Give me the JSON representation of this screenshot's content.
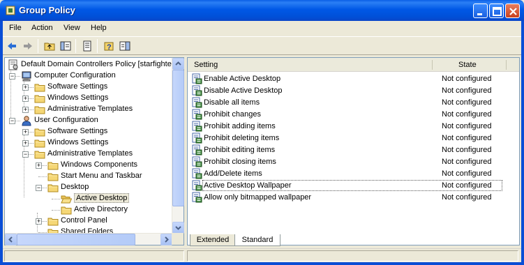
{
  "window": {
    "title": "Group Policy"
  },
  "menu": [
    "File",
    "Action",
    "View",
    "Help"
  ],
  "toolbar": {
    "icons": [
      "back-arrow-icon",
      "forward-arrow-icon",
      "up-folder-icon",
      "show-hide-tree-icon",
      "export-list-icon",
      "help-icon",
      "properties-icon"
    ]
  },
  "tree": {
    "items": [
      {
        "label": "Default Domain Controllers Policy [starfighter",
        "icon": "policy-icon",
        "level": 0,
        "expander": ""
      },
      {
        "label": "Computer Configuration",
        "icon": "computer-icon",
        "level": 1,
        "expander": "−"
      },
      {
        "label": "Software Settings",
        "icon": "folder-icon",
        "level": 2,
        "expander": "+"
      },
      {
        "label": "Windows Settings",
        "icon": "folder-icon",
        "level": 2,
        "expander": "+"
      },
      {
        "label": "Administrative Templates",
        "icon": "folder-icon",
        "level": 2,
        "expander": "+"
      },
      {
        "label": "User Configuration",
        "icon": "user-icon",
        "level": 1,
        "expander": "−"
      },
      {
        "label": "Software Settings",
        "icon": "folder-icon",
        "level": 2,
        "expander": "+"
      },
      {
        "label": "Windows Settings",
        "icon": "folder-icon",
        "level": 2,
        "expander": "+"
      },
      {
        "label": "Administrative Templates",
        "icon": "folder-icon",
        "level": 2,
        "expander": "−"
      },
      {
        "label": "Windows Components",
        "icon": "folder-icon",
        "level": 3,
        "expander": "+"
      },
      {
        "label": "Start Menu and Taskbar",
        "icon": "folder-icon",
        "level": 3,
        "expander": ""
      },
      {
        "label": "Desktop",
        "icon": "folder-icon",
        "level": 3,
        "expander": "−"
      },
      {
        "label": "Active Desktop",
        "icon": "open-folder-icon",
        "level": 4,
        "expander": "",
        "selected": true
      },
      {
        "label": "Active Directory",
        "icon": "folder-icon",
        "level": 4,
        "expander": ""
      },
      {
        "label": "Control Panel",
        "icon": "folder-icon",
        "level": 3,
        "expander": "+"
      },
      {
        "label": "Shared Folders",
        "icon": "folder-icon",
        "level": 3,
        "expander": ""
      }
    ]
  },
  "list": {
    "columns": {
      "setting": "Setting",
      "state": "State"
    },
    "rows": [
      {
        "setting": "Enable Active Desktop",
        "state": "Not configured"
      },
      {
        "setting": "Disable Active Desktop",
        "state": "Not configured"
      },
      {
        "setting": "Disable all items",
        "state": "Not configured"
      },
      {
        "setting": "Prohibit changes",
        "state": "Not configured"
      },
      {
        "setting": "Prohibit adding items",
        "state": "Not configured"
      },
      {
        "setting": "Prohibit deleting items",
        "state": "Not configured"
      },
      {
        "setting": "Prohibit editing items",
        "state": "Not configured"
      },
      {
        "setting": "Prohibit closing items",
        "state": "Not configured"
      },
      {
        "setting": "Add/Delete items",
        "state": "Not configured"
      },
      {
        "setting": "Active Desktop Wallpaper",
        "state": "Not configured",
        "focused": true
      },
      {
        "setting": "Allow only bitmapped wallpaper",
        "state": "Not configured"
      }
    ]
  },
  "tabs": [
    "Extended",
    "Standard"
  ],
  "colors": {
    "titlebar": "#0058e6",
    "selection": "#ece9d8",
    "pane_border": "#7f9db9"
  }
}
